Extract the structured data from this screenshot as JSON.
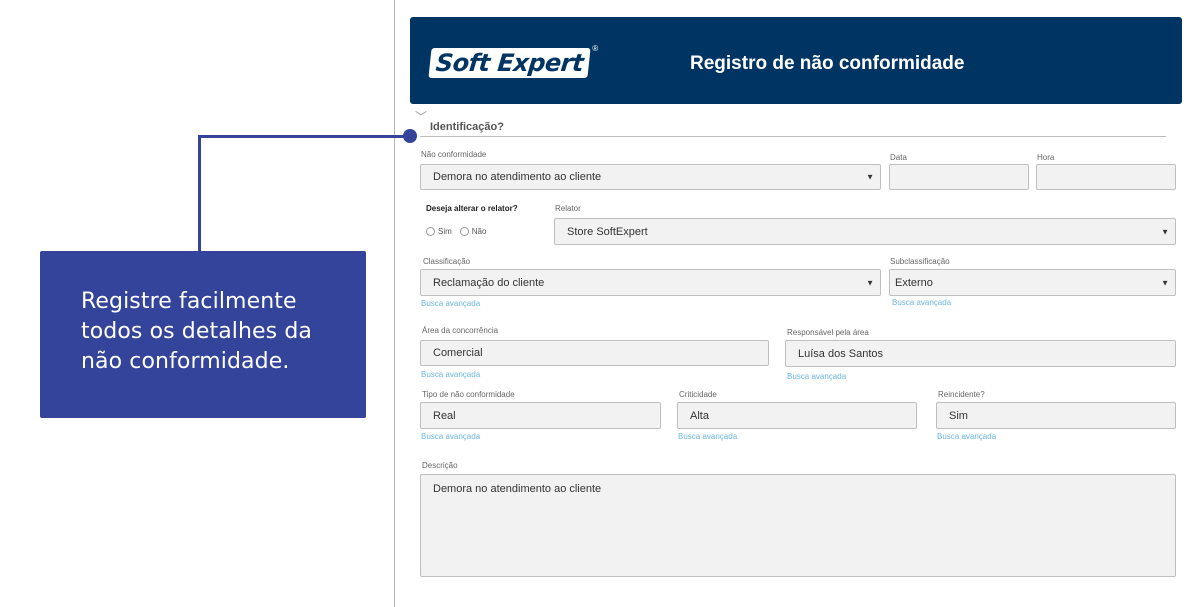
{
  "callout": {
    "text": "Registre facilmente todos os detalhes da não conformidade."
  },
  "header": {
    "logo": "Soft Expert",
    "logo_mark": "®",
    "title": "Registro de não conformidade"
  },
  "section": {
    "title": "Identificação?",
    "chevron": "﹀"
  },
  "fields": {
    "nc": {
      "label": "Não conformidade",
      "value": "Demora no atendimento ao cliente"
    },
    "data": {
      "label": "Data",
      "value": ""
    },
    "hora": {
      "label": "Hora",
      "value": ""
    },
    "alterar": {
      "label": "Deseja alterar o relator?",
      "opt_sim": "Sim",
      "opt_nao": "Não"
    },
    "relator": {
      "label": "Relator",
      "value": "Store SoftExpert"
    },
    "classificacao": {
      "label": "Classificação",
      "value": "Reclamação do cliente",
      "link": "Busca avançada"
    },
    "subclassificacao": {
      "label": "Subclassificação",
      "value": "Externo",
      "link": "Busca avançada"
    },
    "area": {
      "label": "Área da concorrência",
      "value": "Comercial",
      "link": "Busca avançada"
    },
    "responsavel": {
      "label": "Responsável pela área",
      "value": "Luísa dos Santos",
      "link": "Busca avançada"
    },
    "tipo": {
      "label": "Tipo de não conformidade",
      "value": "Real",
      "link": "Busca avançada"
    },
    "criticidade": {
      "label": "Criticidade",
      "value": "Alta",
      "link": "Busca avançada"
    },
    "reincidente": {
      "label": "Reincidente?",
      "value": "Sim",
      "link": "Busca avançada"
    },
    "descricao": {
      "label": "Descrição",
      "value": "Demora no atendimento ao cliente"
    }
  },
  "colors": {
    "header_bg": "#003463",
    "callout_bg": "#33449a",
    "link": "#6bb6e3"
  }
}
